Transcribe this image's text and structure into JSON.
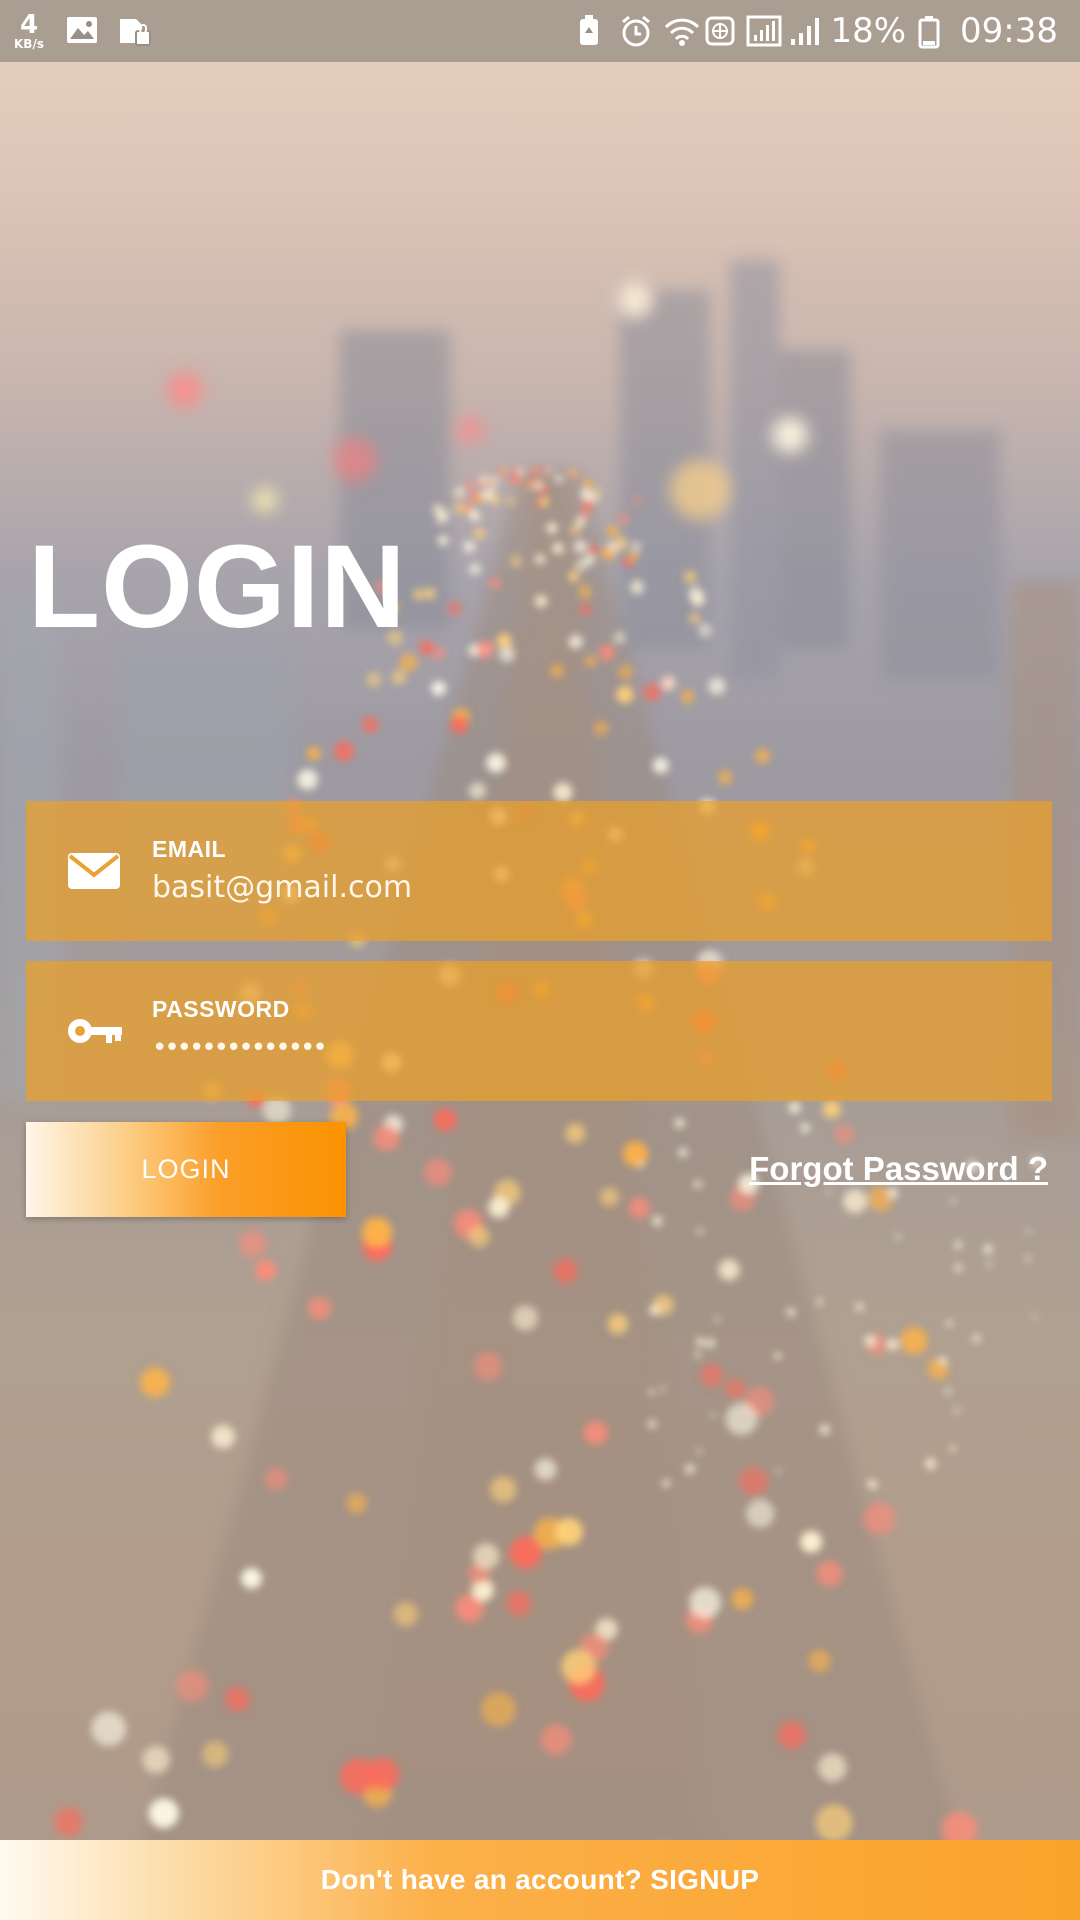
{
  "status_bar": {
    "speed_value": "4",
    "speed_unit": "KB/s",
    "battery": "18%",
    "time": "09:38",
    "icons": [
      "image-icon",
      "sd-card-lock-icon",
      "battery-saver-icon",
      "alarm-icon",
      "wifi-icon",
      "vpn-globe-icon",
      "signal-icon",
      "signal-bars-icon",
      "battery-icon"
    ]
  },
  "title": "LOGIN",
  "email": {
    "label": "EMAIL",
    "value": "basit@gmail.com",
    "icon": "envelope-icon"
  },
  "password": {
    "label": "PASSWORD",
    "value": "••••••••••••••",
    "icon": "key-icon"
  },
  "login_button": {
    "label": "LOGIN"
  },
  "forgot_password": {
    "label": "Forgot Password ?"
  },
  "signup": {
    "label": "Don't have an account? SIGNUP"
  },
  "colors": {
    "accent": "#fb9200",
    "field_bg": "#eba028",
    "text": "#ffffff"
  }
}
